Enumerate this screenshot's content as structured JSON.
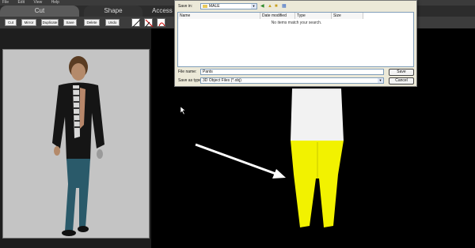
{
  "menu": [
    "File",
    "Edit",
    "View",
    "Help"
  ],
  "tabs": {
    "cut": "Cut",
    "shape": "Shape",
    "access": "Access"
  },
  "toolbar": {
    "cut": "Cut",
    "mirror": "Mirror",
    "duplicate": "Duplicate",
    "save": "Save",
    "delete": "Delete",
    "undo": "Undo"
  },
  "dialog": {
    "save_in_label": "Save in:",
    "save_in_value": "MALE",
    "columns": [
      "Name",
      "Date modified",
      "Type",
      "Size"
    ],
    "empty_message": "No items match your search.",
    "filename_label": "File name:",
    "filename_value": "Pants",
    "savetype_label": "Save as type:",
    "savetype_value": "3D Object Files (*.obj)",
    "save_button": "Save",
    "cancel_button": "Cancel"
  },
  "colors": {
    "yellow_mesh": "#f2f200",
    "white_mesh": "#f2f2f2",
    "viewport_grey": "#c4c4c4"
  }
}
